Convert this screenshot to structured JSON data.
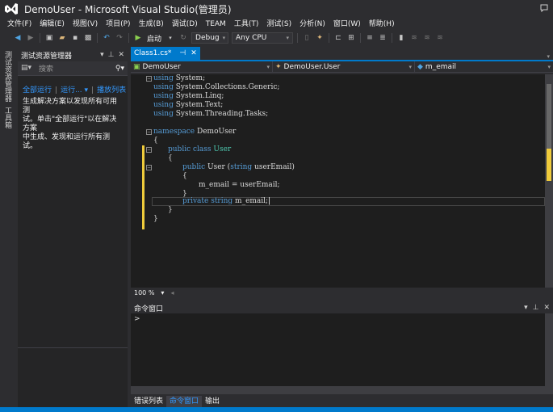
{
  "window": {
    "title": "DemoUser - Microsoft Visual Studio(管理员)"
  },
  "menu": [
    "文件(F)",
    "编辑(E)",
    "视图(V)",
    "项目(P)",
    "生成(B)",
    "调试(D)",
    "TEAM",
    "工具(T)",
    "测试(S)",
    "分析(N)",
    "窗口(W)",
    "帮助(H)"
  ],
  "toolbar": {
    "start_label": "启动",
    "config": "Debug",
    "platform": "Any CPU"
  },
  "left_tabs": [
    "测试资源管理器",
    "工具箱"
  ],
  "test_explorer": {
    "title": "测试资源管理器",
    "search_placeholder": "搜索",
    "run_all": "全部运行",
    "run": "运行...",
    "playlist": "播放列表",
    "description": "生成解决方案以发现所有可用测\n试。单击\"全部运行\"以在解决方案\n中生成、发现和运行所有测试。"
  },
  "editor": {
    "tab_label": "Class1.cs*",
    "nav_project": "DemoUser",
    "nav_class": "DemoUser.User",
    "nav_member": "m_email",
    "zoom": "100 %",
    "code": {
      "u1_kw": "using",
      "u1_ns": " System;",
      "u2_kw": "using",
      "u2_ns": " System.Collections.Generic;",
      "u3_kw": "using",
      "u3_ns": " System.Linq;",
      "u4_kw": "using",
      "u4_ns": " System.Text;",
      "u5_kw": "using",
      "u5_ns": " System.Threading.Tasks;",
      "ns_kw": "namespace",
      "ns_name": " DemoUser",
      "brace_open": "{",
      "cls_kw": "public class",
      "cls_name": " User",
      "ctor_kw": "public",
      "ctor_name": " User (",
      "ctor_type": "string",
      "ctor_param": " userEmail)",
      "assign": "m_email = userEmail;",
      "brace_close": "}",
      "field_kw": "private string",
      "field_name": " m_email;"
    }
  },
  "command_window": {
    "title": "命令窗口",
    "prompt": ">"
  },
  "bottom_tabs": [
    "错误列表",
    "命令窗口",
    "输出"
  ]
}
